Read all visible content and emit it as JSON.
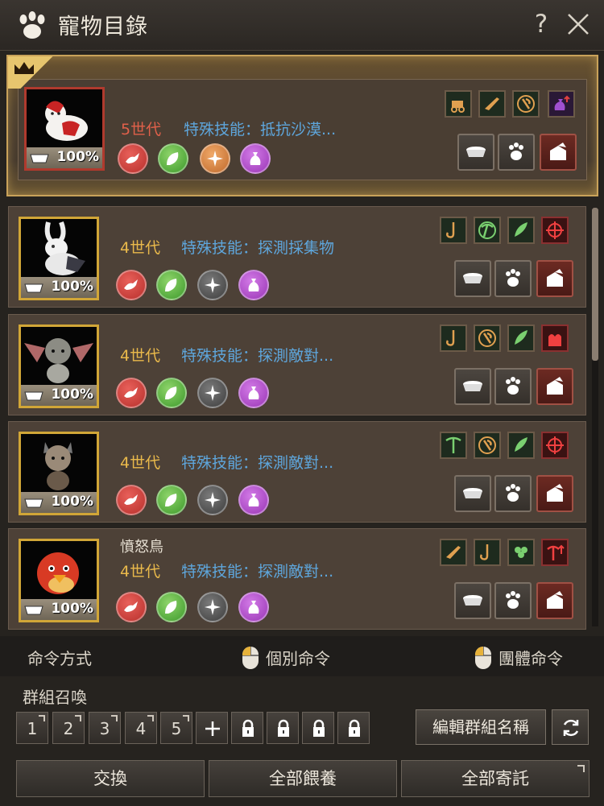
{
  "window": {
    "title": "寵物目錄",
    "help_label": "?"
  },
  "pets": [
    {
      "name": "",
      "generation": "5世代",
      "special_skill": "特殊技能：抵抗沙漠...",
      "food_percent": "100%",
      "active": true
    },
    {
      "name": "",
      "generation": "4世代",
      "special_skill": "特殊技能：探測採集物",
      "food_percent": "100%",
      "active": false
    },
    {
      "name": "",
      "generation": "4世代",
      "special_skill": "特殊技能：探測敵對...",
      "food_percent": "100%",
      "active": false
    },
    {
      "name": "",
      "generation": "4世代",
      "special_skill": "特殊技能：探測敵對...",
      "food_percent": "100%",
      "active": false
    },
    {
      "name": "憤怒鳥",
      "generation": "4世代",
      "special_skill": "特殊技能：探測敵對...",
      "food_percent": "100%",
      "active": false
    }
  ],
  "commands": {
    "label": "命令方式",
    "individual": "個別命令",
    "group": "團體命令"
  },
  "group_summon": {
    "label": "群組召喚",
    "slots": [
      "1",
      "2",
      "3",
      "4",
      "5"
    ],
    "rename_label": "編輯群組名稱"
  },
  "footer": {
    "exchange": "交換",
    "feed_all": "全部餵養",
    "entrust_all": "全部寄託"
  },
  "colors": {
    "gold_frame": "#c9a25a",
    "generation_gold": "#e9b94b",
    "generation_red": "#e0604a",
    "skill_blue": "#5ea6dc"
  }
}
